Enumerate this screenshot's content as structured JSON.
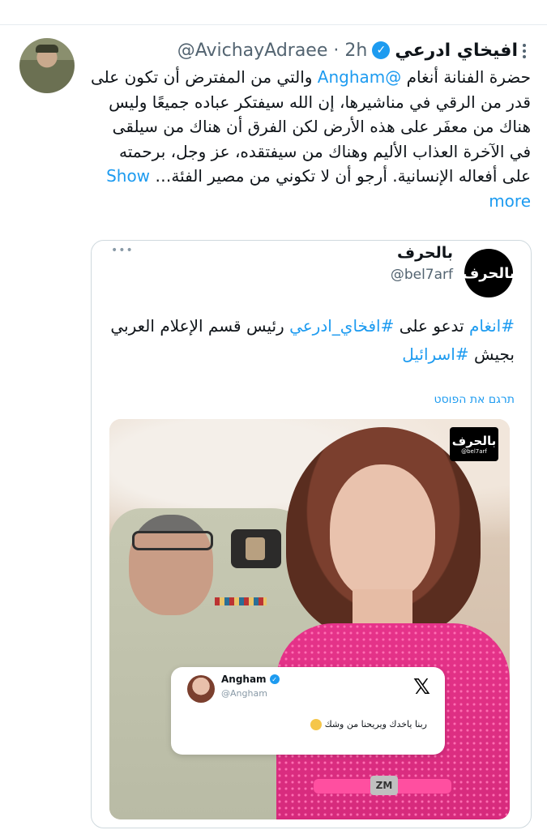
{
  "tweet": {
    "display_name": "افيخاي ادرعي",
    "handle": "@AvichayAdraee",
    "separator": "·",
    "time": "2h",
    "text_before_mention": "حضرة الفنانة أنغام ",
    "mention": "@Angham",
    "text_after_mention": " والتي من المفترض أن تكون على قدر من الرقي في مناشيرها، إن الله سيفتكر عباده جميعًا وليس هناك من معفَر على هذه الأرض لكن الفرق أن هناك من سيلقى في الآخرة العذاب الأليم وهناك من سيفتقده، عز وجل، برحمته على أفعاله الإنسانية. أرجو أن لا تكوني من مصير الفئة… ",
    "show_more": "Show more"
  },
  "quote": {
    "display_name": "بالحرف",
    "handle": "@bel7arf",
    "avatar_text": "بالحرف",
    "hashtag_angham": "#انغام",
    "text_1": " تدعو على ",
    "hashtag_avichay": "#افخاي_ادرعي",
    "text_2": " رئيس قسم الإعلام العربي بجيش ",
    "hashtag_israel": "#اسرائيل",
    "translate_label": "תרגם את הפוסט"
  },
  "media": {
    "logo_text": "بالحرف",
    "logo_sub": "@bel7arf",
    "buckle_text": "ZM",
    "embedded_post": {
      "name": "Angham",
      "handle": "@Angham",
      "text": "ربنا ياخدك ويريحنا من وشك"
    }
  },
  "colors": {
    "link": "#1d9bf0",
    "text": "#0f1419",
    "muted": "#536471",
    "dress": "#e6338a"
  }
}
